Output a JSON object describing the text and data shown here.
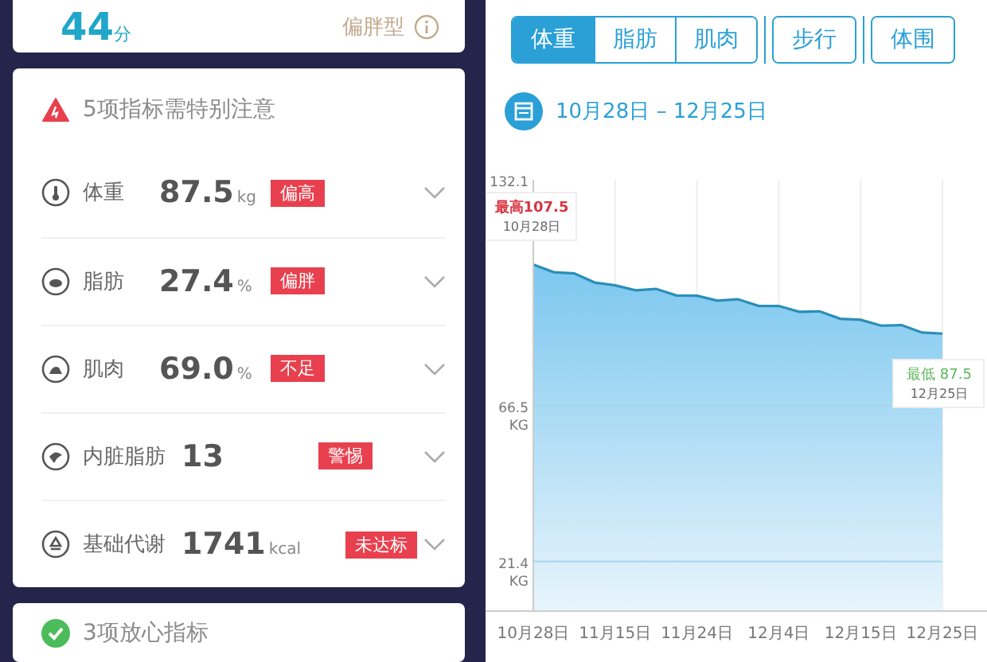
{
  "score": {
    "value": "44",
    "unit": "分",
    "body_type": "偏胖型"
  },
  "warning": {
    "title": "5项指标需特别注意",
    "rows": [
      {
        "name": "体重",
        "value": "87.5",
        "unit": "kg",
        "tag": "偏高"
      },
      {
        "name": "脂肪",
        "value": "27.4",
        "unit": "%",
        "tag": "偏胖"
      },
      {
        "name": "肌肉",
        "value": "69.0",
        "unit": "%",
        "tag": "不足"
      },
      {
        "name": "内脏脂肪",
        "value": "13",
        "tag": "警惕"
      },
      {
        "name": "基础代谢",
        "value": "1741",
        "unit": "kcal",
        "tag": "未达标"
      }
    ]
  },
  "safe": {
    "title": "3项放心指标"
  },
  "tab_groups": [
    [
      {
        "label": "体重",
        "selected": true
      },
      {
        "label": "脂肪",
        "selected": false
      },
      {
        "label": "肌肉",
        "selected": false
      }
    ],
    [
      {
        "label": "步行",
        "selected": false
      }
    ],
    [
      {
        "label": "体围",
        "selected": false
      }
    ]
  ],
  "date_range": "10月28日 – 12月25日",
  "chart": {
    "chart_data": {
      "type": "area",
      "categories": [
        "10月28日",
        "11月15日",
        "11月24日",
        "12月4日",
        "12月15日",
        "12月25日"
      ],
      "series": [
        {
          "color": "#2a8fb8",
          "values": [
            107.5,
            101.5,
            98.5,
            95.5,
            91.5,
            87.5
          ]
        }
      ],
      "grid": true,
      "ylim": [
        7,
        132.1
      ],
      "yticks": [
        {
          "value": 132.1,
          "label": "132.1"
        },
        {
          "value": 66.5,
          "label": "66.5 KG"
        },
        {
          "value": 21.4,
          "label": "21.4 KG"
        }
      ]
    },
    "callouts": [
      {
        "kind": "high",
        "label": "最高",
        "value": "107.5",
        "date": "10月28日"
      },
      {
        "kind": "low",
        "label": "最低",
        "value": "87.5",
        "date": "12月25日"
      }
    ]
  }
}
